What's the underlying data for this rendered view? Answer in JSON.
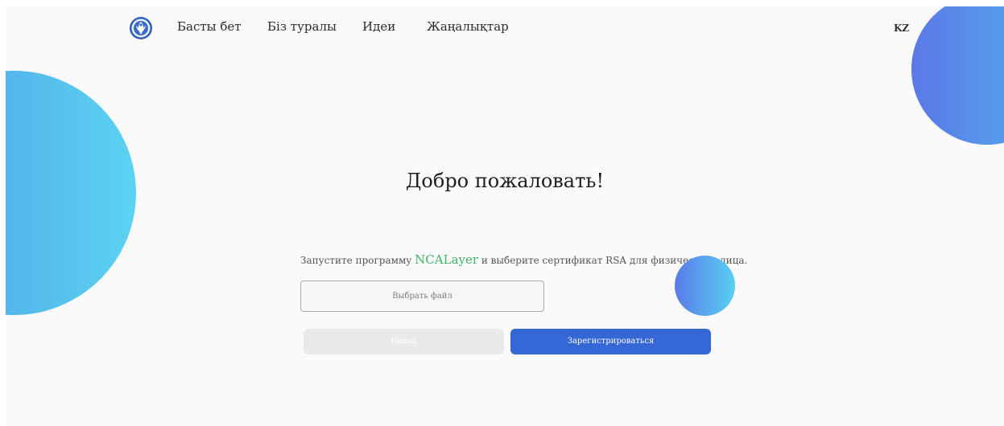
{
  "header": {
    "logo_icon": "emblem-logo-icon",
    "nav": [
      {
        "label": "Басты бет"
      },
      {
        "label": "Біз туралы"
      },
      {
        "label": "Идеи"
      },
      {
        "label": "Жаңалықтар"
      }
    ],
    "language": "KZ"
  },
  "main": {
    "title": "Добро пожаловать!",
    "instruction_before": "Запустите программу ",
    "instruction_accent": "NCALayer",
    "instruction_after": " и выберите сертификат RSA для физического лица.",
    "file_button_label": "Выбрать файл",
    "back_button_label": "Назад",
    "register_button_label": "Зарегистрироваться"
  },
  "colors": {
    "primary": "#3667d6",
    "accent": "#41b26a",
    "disabled": "#e9e9e9",
    "background": "#fafafa"
  }
}
